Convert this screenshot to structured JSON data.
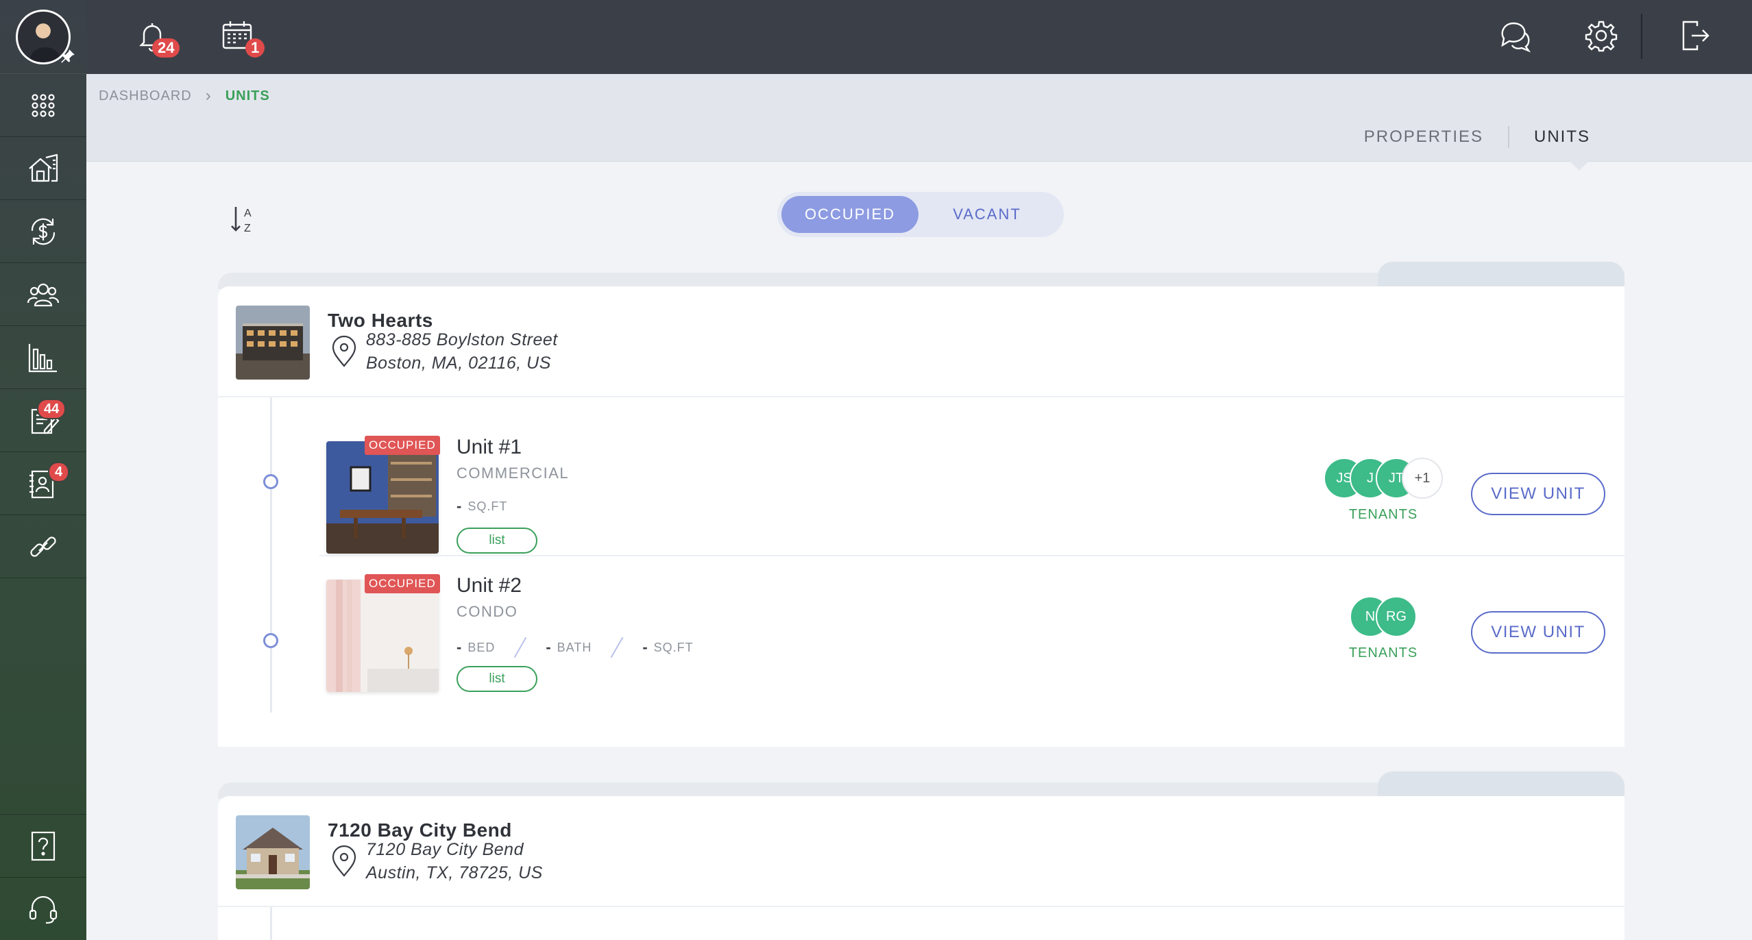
{
  "sidebar": {
    "user": {
      "avatar_alt": "user avatar"
    },
    "items": [
      {
        "icon": "apps-grid-icon"
      },
      {
        "icon": "properties-icon"
      },
      {
        "icon": "payments-icon"
      },
      {
        "icon": "tenants-icon"
      },
      {
        "icon": "reports-icon"
      },
      {
        "icon": "leases-icon",
        "badge": "44"
      },
      {
        "icon": "applications-icon",
        "badge": "4"
      },
      {
        "icon": "integrations-icon"
      }
    ],
    "bottom": [
      {
        "icon": "help-icon"
      },
      {
        "icon": "support-headset-icon"
      }
    ]
  },
  "topbar": {
    "notifications_count": "24",
    "calendar_count": "1"
  },
  "breadcrumb": {
    "home": "DASHBOARD",
    "current": "UNITS"
  },
  "view_tabs": {
    "properties": "PROPERTIES",
    "units": "UNITS"
  },
  "filter": {
    "occupied": "OCCUPIED",
    "vacant": "VACANT"
  },
  "properties": [
    {
      "name": "Two Hearts",
      "address_line1": "883-885 Boylston Street",
      "address_line2": "Boston, MA, 02116, US",
      "units": [
        {
          "badge": "OCCUPIED",
          "title": "Unit #1",
          "type": "COMMERCIAL",
          "sqft_value": "-",
          "sqft_label": "SQ.FT",
          "list_label": "list",
          "tenants": [
            "JS",
            "J",
            "JT"
          ],
          "tenants_more": "+1",
          "tenants_label": "TENANTS",
          "view_label": "VIEW UNIT"
        },
        {
          "badge": "OCCUPIED",
          "title": "Unit #2",
          "type": "CONDO",
          "bed_value": "-",
          "bed_label": "BED",
          "bath_value": "-",
          "bath_label": "BATH",
          "sqft_value": "-",
          "sqft_label": "SQ.FT",
          "list_label": "list",
          "tenants": [
            "N",
            "RG"
          ],
          "tenants_label": "TENANTS",
          "view_label": "VIEW UNIT"
        }
      ]
    },
    {
      "name": "7120 Bay City Bend",
      "address_line1": "7120 Bay City Bend",
      "address_line2": "Austin, TX, 78725, US",
      "units": []
    }
  ],
  "colors": {
    "accent_blue": "#5a6bc9",
    "accent_green": "#3aa05a",
    "badge_red": "#e04a4a",
    "tenant_green": "#3dbb89"
  }
}
